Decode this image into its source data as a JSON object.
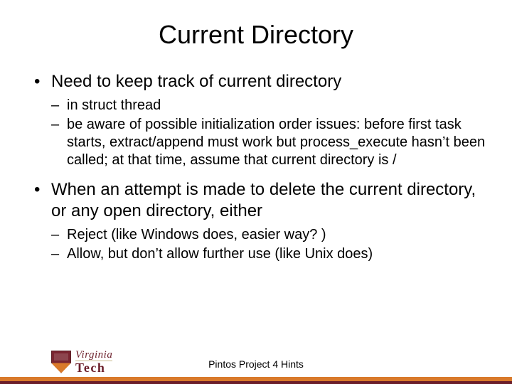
{
  "title": "Current Directory",
  "bullets": {
    "b1": {
      "text": "Need to keep track of current directory",
      "sub": {
        "s1": "in struct thread",
        "s2": "be aware of possible initialization order issues: before first task starts, extract/append must work but process_execute hasn’t been called; at that time, assume that current directory is /"
      }
    },
    "b2": {
      "text": "When an attempt is made to delete the current directory, or any open directory, either",
      "sub": {
        "s1": "Reject (like Windows does, easier way? )",
        "s2": "Allow, but don’t allow further use (like Unix does)"
      }
    }
  },
  "footer": {
    "title": "Pintos Project 4 Hints",
    "logo": {
      "word1": "Virginia",
      "word2": "Tech"
    }
  }
}
